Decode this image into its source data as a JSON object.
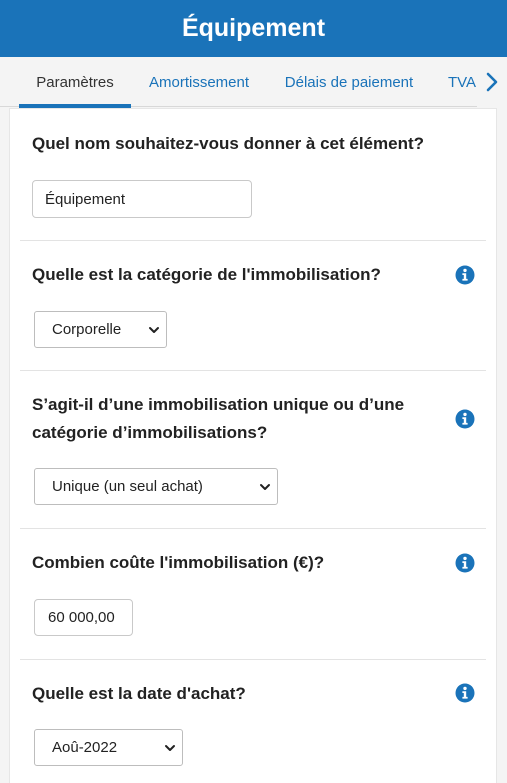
{
  "header": {
    "title": "Équipement"
  },
  "tabs": [
    {
      "label": "Paramètres",
      "active": true
    },
    {
      "label": "Amortissement",
      "active": false
    },
    {
      "label": "Délais de paiement",
      "active": false
    },
    {
      "label": "TVA",
      "active": false
    }
  ],
  "tabs_next_icon": "chevron-right-icon",
  "colors": {
    "brand": "#1a73b9",
    "background": "#f4f4f4",
    "card": "#ffffff"
  },
  "form": {
    "name": {
      "question": "Quel nom souhaitez-vous donner à cet élément?",
      "value": "Équipement"
    },
    "category": {
      "question": "Quelle est la catégorie de l'immobilisation?",
      "selected": "Corporelle",
      "info_icon": "info-icon"
    },
    "type": {
      "question": "S’agit-il d’une immobilisation unique ou d’une catégorie d’immobilisations?",
      "selected": "Unique (un seul achat)",
      "info_icon": "info-icon"
    },
    "cost": {
      "question": "Combien coûte l'immobilisation (€)?",
      "value": "60 000,00",
      "info_icon": "info-icon"
    },
    "date": {
      "question": "Quelle est la date d'achat?",
      "selected": "Aoû-2022",
      "info_icon": "info-icon"
    }
  }
}
